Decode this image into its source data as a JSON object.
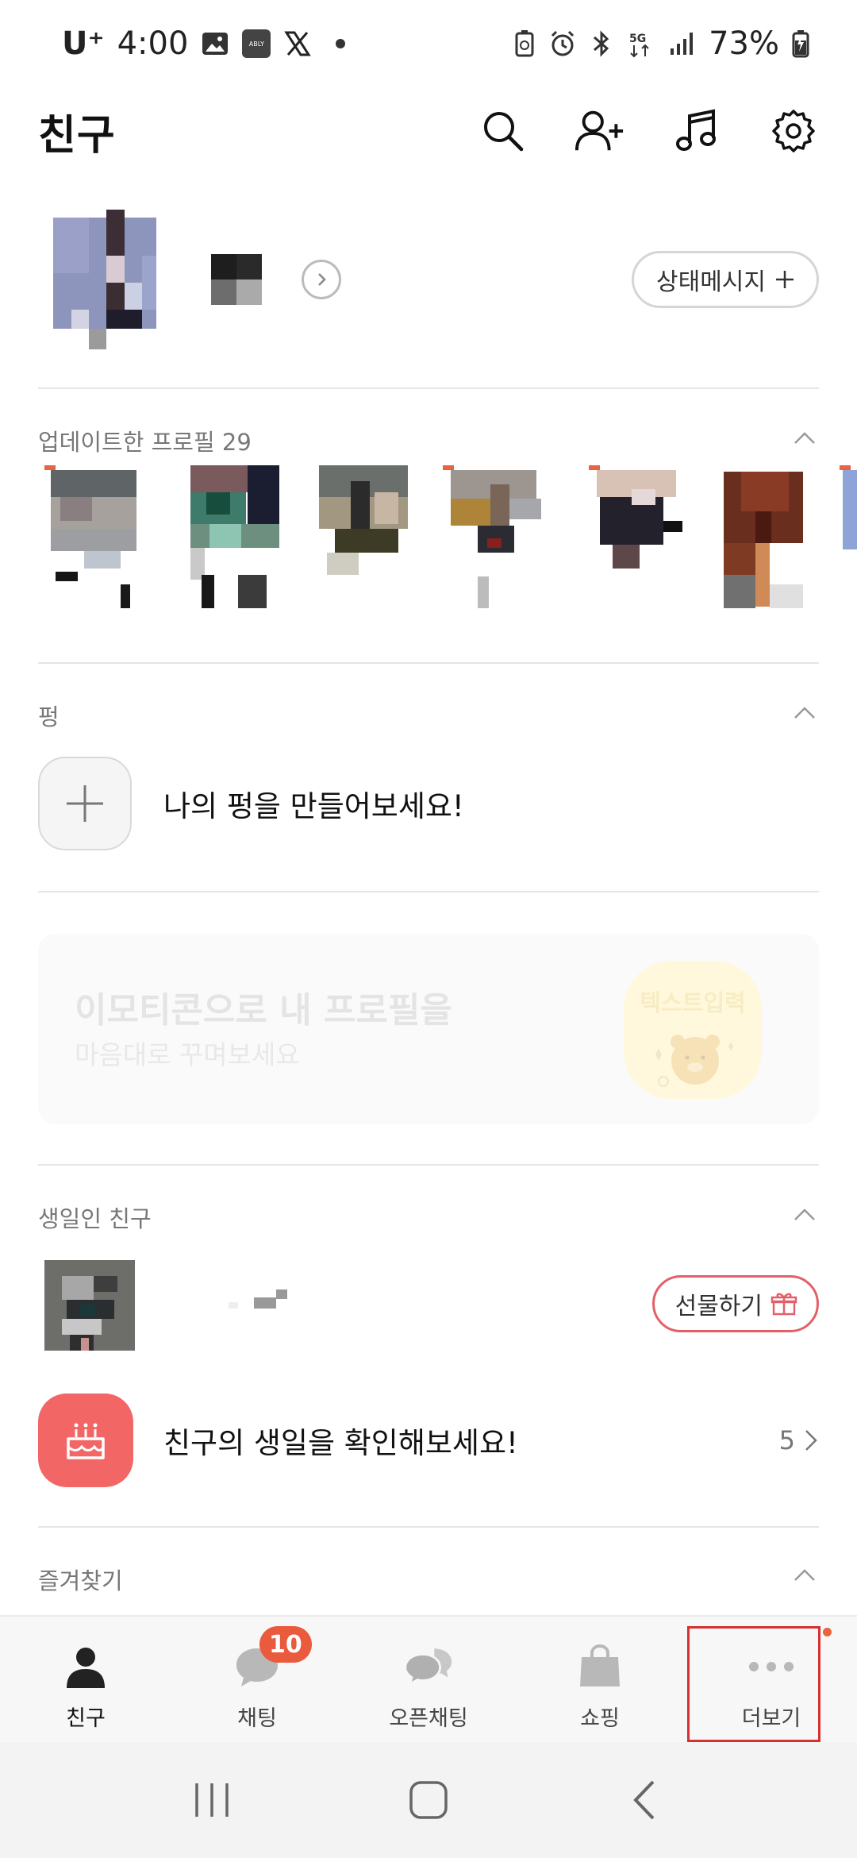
{
  "status_bar": {
    "carrier": "U⁺",
    "time": "4:00",
    "ably_label": "ABLY",
    "battery": "73%"
  },
  "header": {
    "title": "친구"
  },
  "profile": {
    "status_message_label": "상태메시지"
  },
  "updated_profiles": {
    "label": "업데이트한 프로필 29"
  },
  "pyeong": {
    "label": "펑",
    "cta": "나의 펑을 만들어보세요!"
  },
  "emoticon_banner": {
    "title": "이모티콘으로 내 프로필을",
    "subtitle": "마음대로 꾸며보세요",
    "badge_text": "텍스트입력"
  },
  "birthday": {
    "label": "생일인 친구",
    "gift_label": "선물하기",
    "check_text": "친구의 생일을 확인해보세요!",
    "count": "5"
  },
  "favorites": {
    "label": "즐겨찾기"
  },
  "tabs": [
    {
      "label": "친구"
    },
    {
      "label": "채팅",
      "badge": "10"
    },
    {
      "label": "오픈채팅"
    },
    {
      "label": "쇼핑"
    },
    {
      "label": "더보기"
    }
  ],
  "colors": {
    "accent_red": "#f26666",
    "badge_orange": "#ea5a3c",
    "highlight_red": "#d63031"
  }
}
